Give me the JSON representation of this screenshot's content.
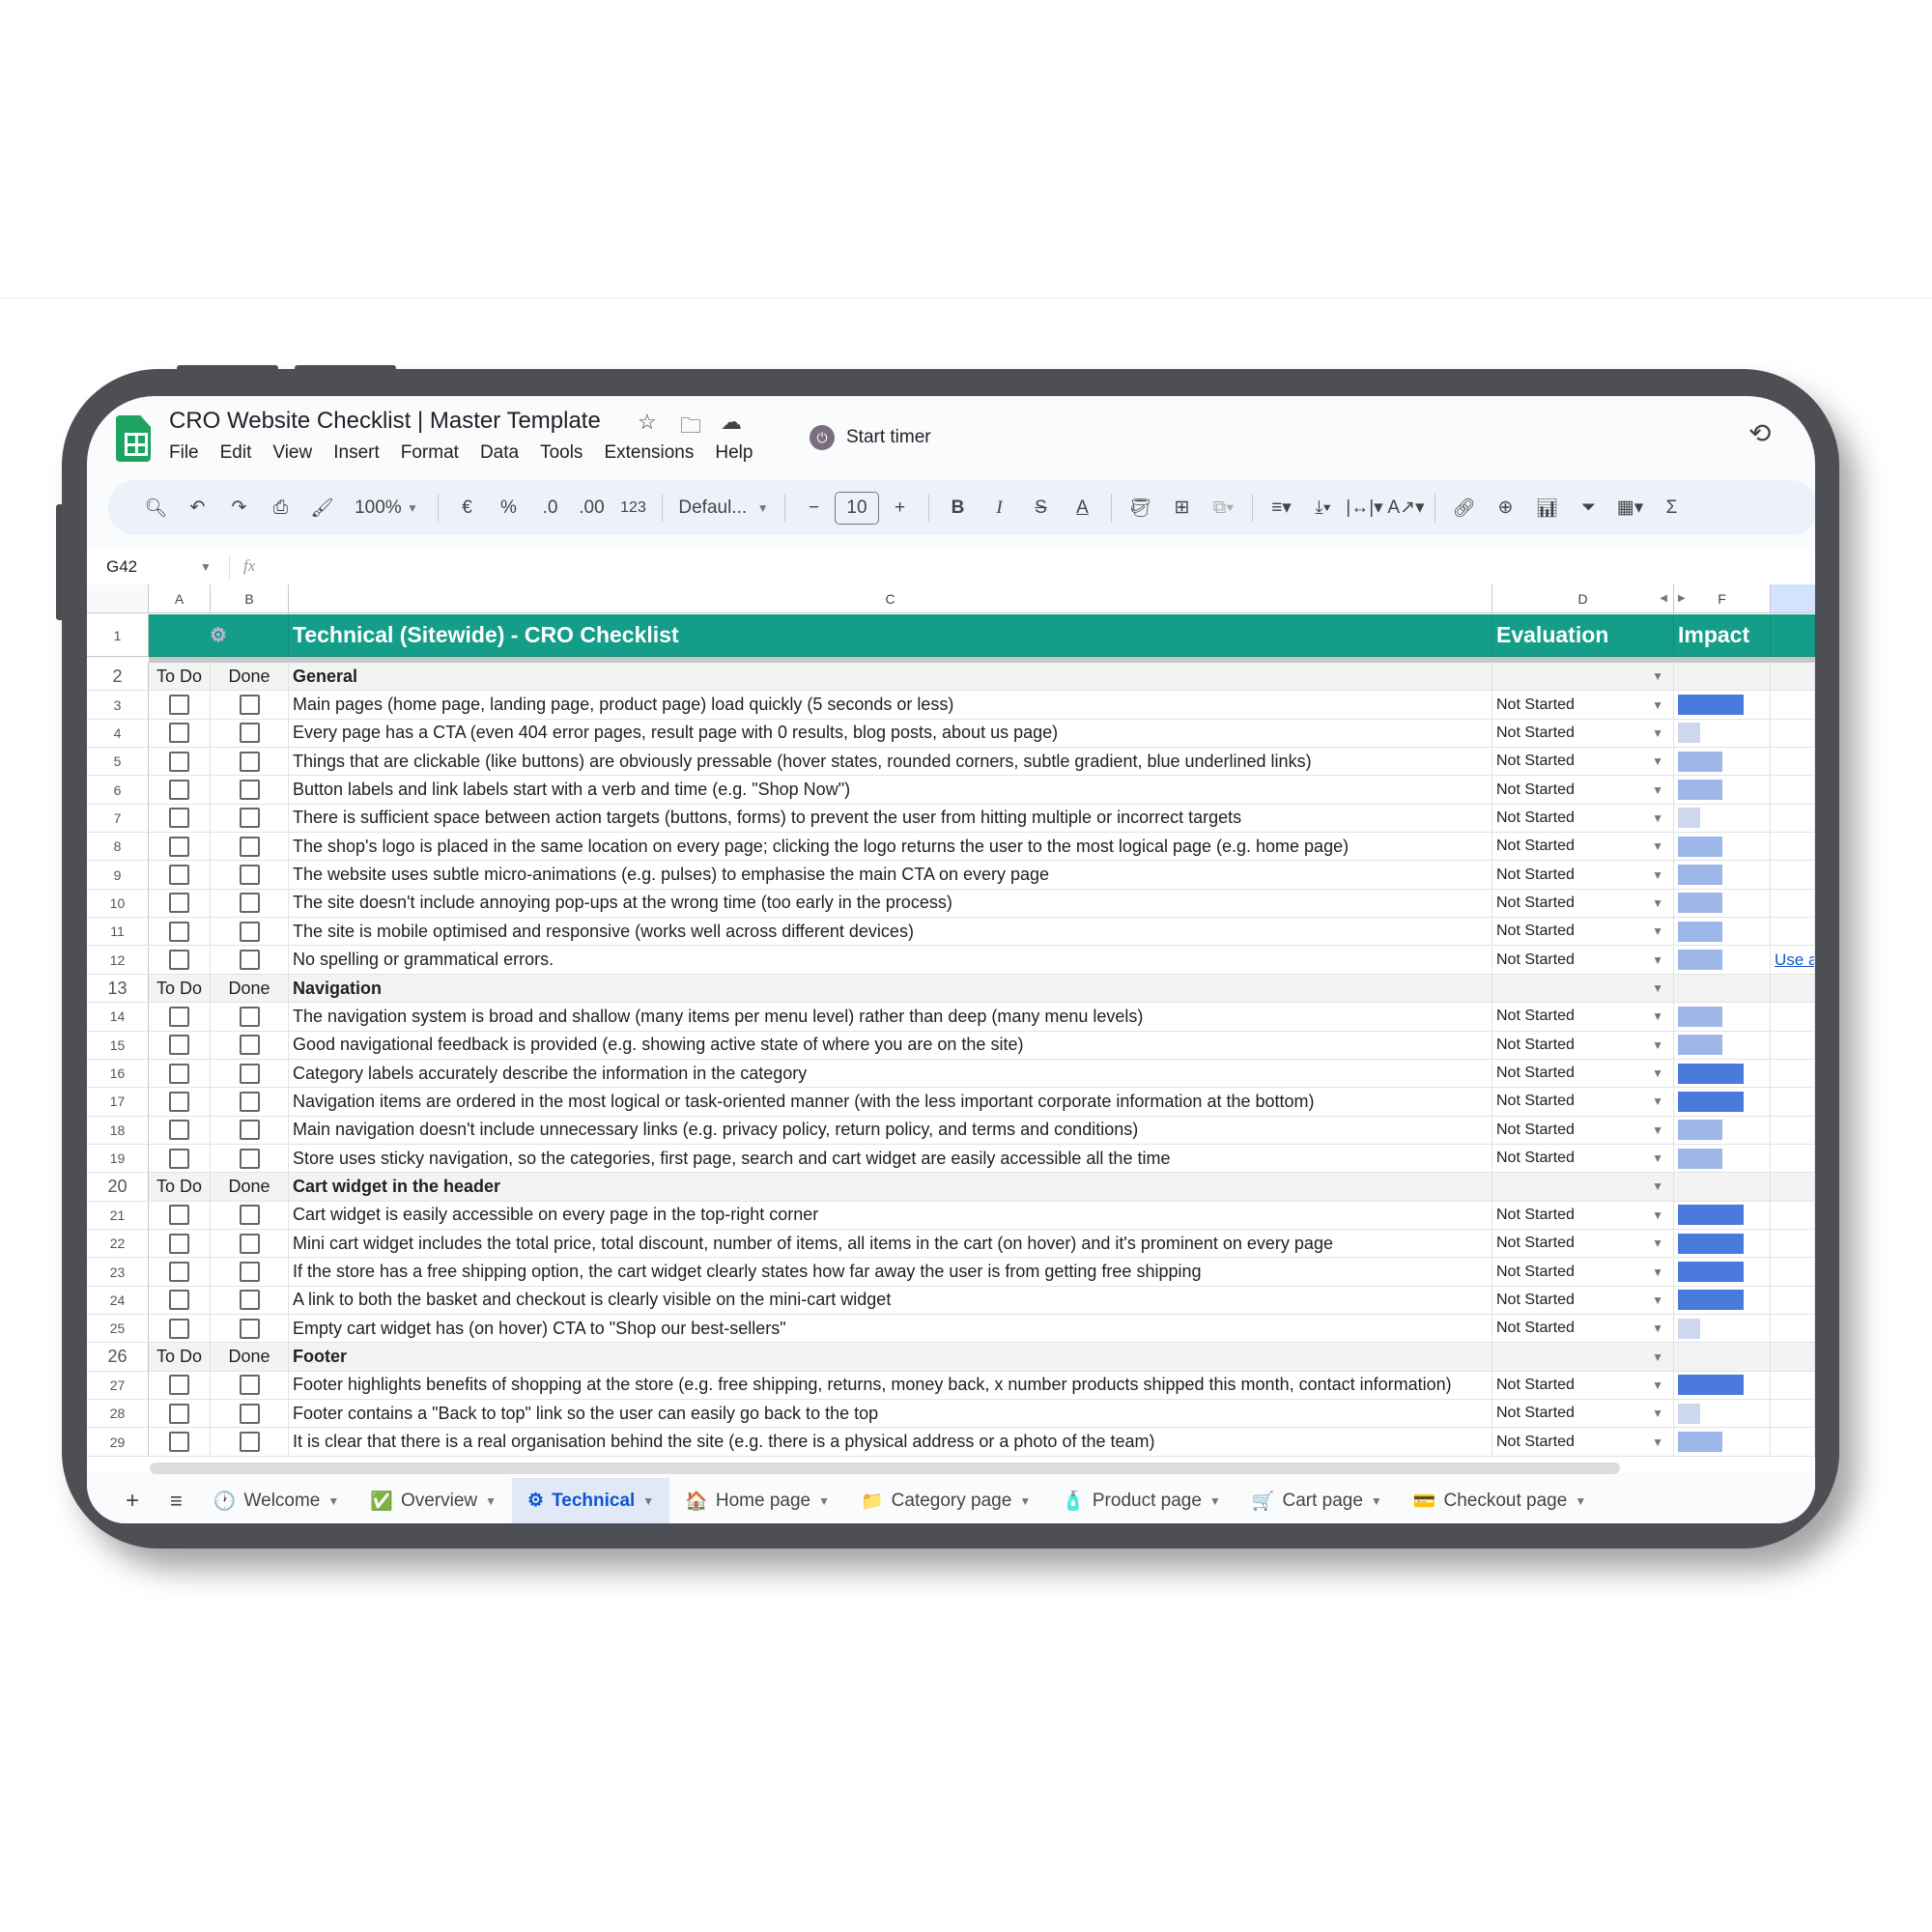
{
  "app": {
    "title": "CRO Website Checklist | Master Template",
    "menu": [
      "File",
      "Edit",
      "View",
      "Insert",
      "Format",
      "Data",
      "Tools",
      "Extensions",
      "Help"
    ],
    "start_timer": "Start timer"
  },
  "toolbar": {
    "zoom": "100%",
    "currency": "€",
    "percent": "%",
    "dec_less": ".0",
    "dec_more": ".00",
    "format_123": "123",
    "font": "Defaul...",
    "font_size": "10"
  },
  "formula_bar": {
    "cell_ref": "G42",
    "fx": "fx"
  },
  "columns": [
    "A",
    "B",
    "C",
    "D",
    "F"
  ],
  "colors": {
    "header_green": "#149e89",
    "impact_high": "#4a7bdc",
    "impact_medium": "#9db7e8",
    "impact_low": "#cdd8ef"
  },
  "sheet": {
    "title": "Technical (Sitewide) - CRO Checklist",
    "evaluation_header": "Evaluation",
    "impact_header": "Impact",
    "todo_label": "To Do",
    "done_label": "Done",
    "status": "Not Started",
    "side_link": "Use a",
    "rows": [
      {
        "n": 2,
        "section": "General"
      },
      {
        "n": 3,
        "text": "Main pages (home page, landing page, product page) load quickly (5 seconds or less)",
        "impact": "high"
      },
      {
        "n": 4,
        "text": "Every page has a CTA (even 404 error pages, result page with 0 results, blog posts, about us page)",
        "impact": "low"
      },
      {
        "n": 5,
        "text": "Things that are clickable (like buttons) are obviously pressable (hover states, rounded corners, subtle gradient, blue underlined links)",
        "impact": "medium"
      },
      {
        "n": 6,
        "text": "Button labels and link labels start with a verb and time (e.g. \"Shop Now\")",
        "impact": "medium"
      },
      {
        "n": 7,
        "text": "There is sufficient space between action targets (buttons, forms) to prevent the user from hitting multiple or incorrect targets",
        "impact": "low"
      },
      {
        "n": 8,
        "text": "The shop's logo is placed in the same location on every page; clicking the logo returns the user to the most logical page (e.g. home page)",
        "impact": "medium"
      },
      {
        "n": 9,
        "text": "The website uses subtle micro-animations (e.g. pulses) to emphasise the main CTA on every page",
        "impact": "medium"
      },
      {
        "n": 10,
        "text": "The site doesn't include annoying pop-ups at the wrong time (too early in the process)",
        "impact": "medium"
      },
      {
        "n": 11,
        "text": "The site is mobile optimised and responsive (works well across different devices)",
        "impact": "medium"
      },
      {
        "n": 12,
        "text": "No spelling or grammatical errors.",
        "impact": "medium",
        "link": true
      },
      {
        "n": 13,
        "section": "Navigation"
      },
      {
        "n": 14,
        "text": "The navigation system is broad and shallow (many items per menu level) rather than deep (many menu levels)",
        "impact": "medium"
      },
      {
        "n": 15,
        "text": "Good navigational feedback is provided (e.g. showing active state of where you are on the site)",
        "impact": "medium"
      },
      {
        "n": 16,
        "text": "Category labels accurately describe the information in the category",
        "impact": "high"
      },
      {
        "n": 17,
        "text": "Navigation items are ordered in the most logical or task-oriented manner (with the less important corporate information at the bottom)",
        "impact": "high"
      },
      {
        "n": 18,
        "text": "Main navigation doesn't include unnecessary links (e.g. privacy policy, return policy, and terms and conditions)",
        "impact": "medium"
      },
      {
        "n": 19,
        "text": "Store uses sticky navigation, so the categories, first page, search and cart widget are easily accessible all the time",
        "impact": "medium"
      },
      {
        "n": 20,
        "section": "Cart widget in the header"
      },
      {
        "n": 21,
        "text": "Cart widget is easily accessible on every page in the top-right corner",
        "impact": "high"
      },
      {
        "n": 22,
        "text": "Mini cart widget includes the total price, total discount, number of items, all items in the cart (on hover) and it's prominent on every page",
        "impact": "high"
      },
      {
        "n": 23,
        "text": "If the store has a free shipping option, the cart widget clearly states how far away the user is from getting free shipping",
        "impact": "high"
      },
      {
        "n": 24,
        "text": "A link to both the basket and checkout is clearly visible on the mini-cart widget",
        "impact": "high"
      },
      {
        "n": 25,
        "text": "Empty cart widget has (on hover) CTA to \"Shop our best-sellers\"",
        "impact": "low"
      },
      {
        "n": 26,
        "section": "Footer"
      },
      {
        "n": 27,
        "text": "Footer highlights benefits of shopping at the store (e.g. free shipping, returns, money back, x number products shipped this month, contact information)",
        "impact": "high"
      },
      {
        "n": 28,
        "text": "Footer contains a \"Back to top\" link so the user can easily go back to the top",
        "impact": "low"
      },
      {
        "n": 29,
        "text": "It is clear that there is a real organisation behind the site (e.g. there is a physical address or a photo of the team)",
        "impact": "medium"
      }
    ]
  },
  "tabs": [
    {
      "label": "Welcome",
      "icon": "clock-icon",
      "glyph": "🕐"
    },
    {
      "label": "Overview",
      "icon": "check-box-icon",
      "glyph": "✅"
    },
    {
      "label": "Technical",
      "icon": "gear-icon",
      "glyph": "⚙",
      "active": true
    },
    {
      "label": "Home page",
      "icon": "house-icon",
      "glyph": "🏠"
    },
    {
      "label": "Category page",
      "icon": "folder-icon",
      "glyph": "📁"
    },
    {
      "label": "Product page",
      "icon": "bottle-icon",
      "glyph": "🧴"
    },
    {
      "label": "Cart page",
      "icon": "cart-icon",
      "glyph": "🛒"
    },
    {
      "label": "Checkout page",
      "icon": "card-icon",
      "glyph": "💳"
    }
  ]
}
